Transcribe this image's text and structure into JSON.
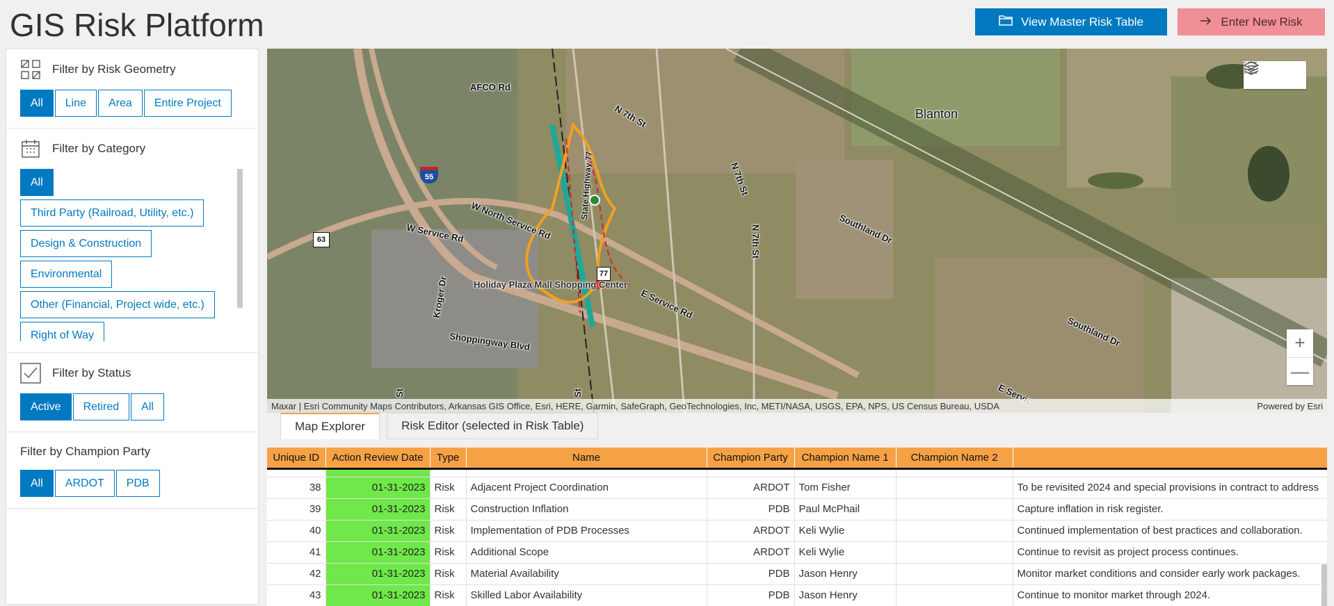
{
  "header": {
    "title": "GIS Risk Platform",
    "view_master_label": "View Master Risk Table",
    "enter_risk_label": "Enter New Risk"
  },
  "sidebar": {
    "geometry": {
      "title": "Filter by Risk Geometry",
      "options": [
        "All",
        "Line",
        "Area",
        "Entire Project"
      ],
      "selected": "All"
    },
    "category": {
      "title": "Filter by Category",
      "options": [
        "All",
        "Third Party (Railroad, Utility, etc.)",
        "Design & Construction",
        "Environmental",
        "Other (Financial, Project wide, etc.)",
        "Right of Way"
      ],
      "selected": "All"
    },
    "status": {
      "title": "Filter by Status",
      "options": [
        "Active",
        "Retired",
        "All"
      ],
      "selected": "Active"
    },
    "champion": {
      "title": "Filter by Champion Party",
      "options": [
        "All",
        "ARDOT",
        "PDB"
      ],
      "selected": "All"
    }
  },
  "map": {
    "labels": {
      "afco": "AFCO Rd",
      "n7th_a": "N 7th St",
      "n7th_b": "N 7th St",
      "n7th_c": "N 7th St",
      "blanton": "Blanton",
      "southland_a": "Southland Dr",
      "southland_b": "Southland Dr",
      "wnorth": "W North Service Rd",
      "wservice": "W Service Rd",
      "eservice": "E Service Rd",
      "eservice2": "E Servic",
      "kroger": "Kroger Dr",
      "shoppingway": "Shoppingway Blvd",
      "holiday": "Holiday Plaza Mall Shopping Center",
      "hwy77": "State Highway 77",
      "st": "St",
      "st2": "St",
      "i55": "55",
      "us63": "63",
      "r77": "77"
    },
    "attribution": "Maxar | Esri Community Maps Contributors, Arkansas GIS Office, Esri, HERE, Garmin, SafeGraph, GeoTechnologies, Inc, METI/NASA, USGS, EPA, NPS, US Census Bureau, USDA",
    "powered_by": "Powered by Esri",
    "zoom_in": "+",
    "zoom_out": "—"
  },
  "tabs": [
    {
      "label": "Map Explorer",
      "active": true
    },
    {
      "label": "Risk Editor (selected in Risk Table)",
      "active": false
    }
  ],
  "table": {
    "columns": [
      "Unique ID",
      "Action Review Date",
      "Type",
      "Name",
      "Champion Party",
      "Champion Name 1",
      "Champion Name 2",
      ""
    ],
    "rows": [
      [
        "38",
        "01-31-2023",
        "Risk",
        "Adjacent Project Coordination",
        "ARDOT",
        "Tom Fisher",
        "",
        "To be revisited 2024 and special provisions in contract to address"
      ],
      [
        "39",
        "01-31-2023",
        "Risk",
        "Construction Inflation",
        "PDB",
        "Paul McPhail",
        "",
        "Capture inflation in risk register."
      ],
      [
        "40",
        "01-31-2023",
        "Risk",
        "Implementation of PDB Processes",
        "ARDOT",
        "Keli Wylie",
        "",
        "Continued implementation of best practices and collaboration."
      ],
      [
        "41",
        "01-31-2023",
        "Risk",
        "Additional Scope",
        "ARDOT",
        "Keli Wylie",
        "",
        "Continue to revisit as project process continues."
      ],
      [
        "42",
        "01-31-2023",
        "Risk",
        "Material Availability",
        "PDB",
        "Jason Henry",
        "",
        "Monitor market conditions and consider early work packages."
      ],
      [
        "43",
        "01-31-2023",
        "Risk",
        "Skilled Labor Availability",
        "PDB",
        "Jason Henry",
        "",
        "Continue to monitor market through 2024."
      ]
    ]
  },
  "colors": {
    "primary": "#0079c1",
    "danger": "#f08f95",
    "table_header": "#f5a247",
    "date_cell": "#6fe84a"
  }
}
